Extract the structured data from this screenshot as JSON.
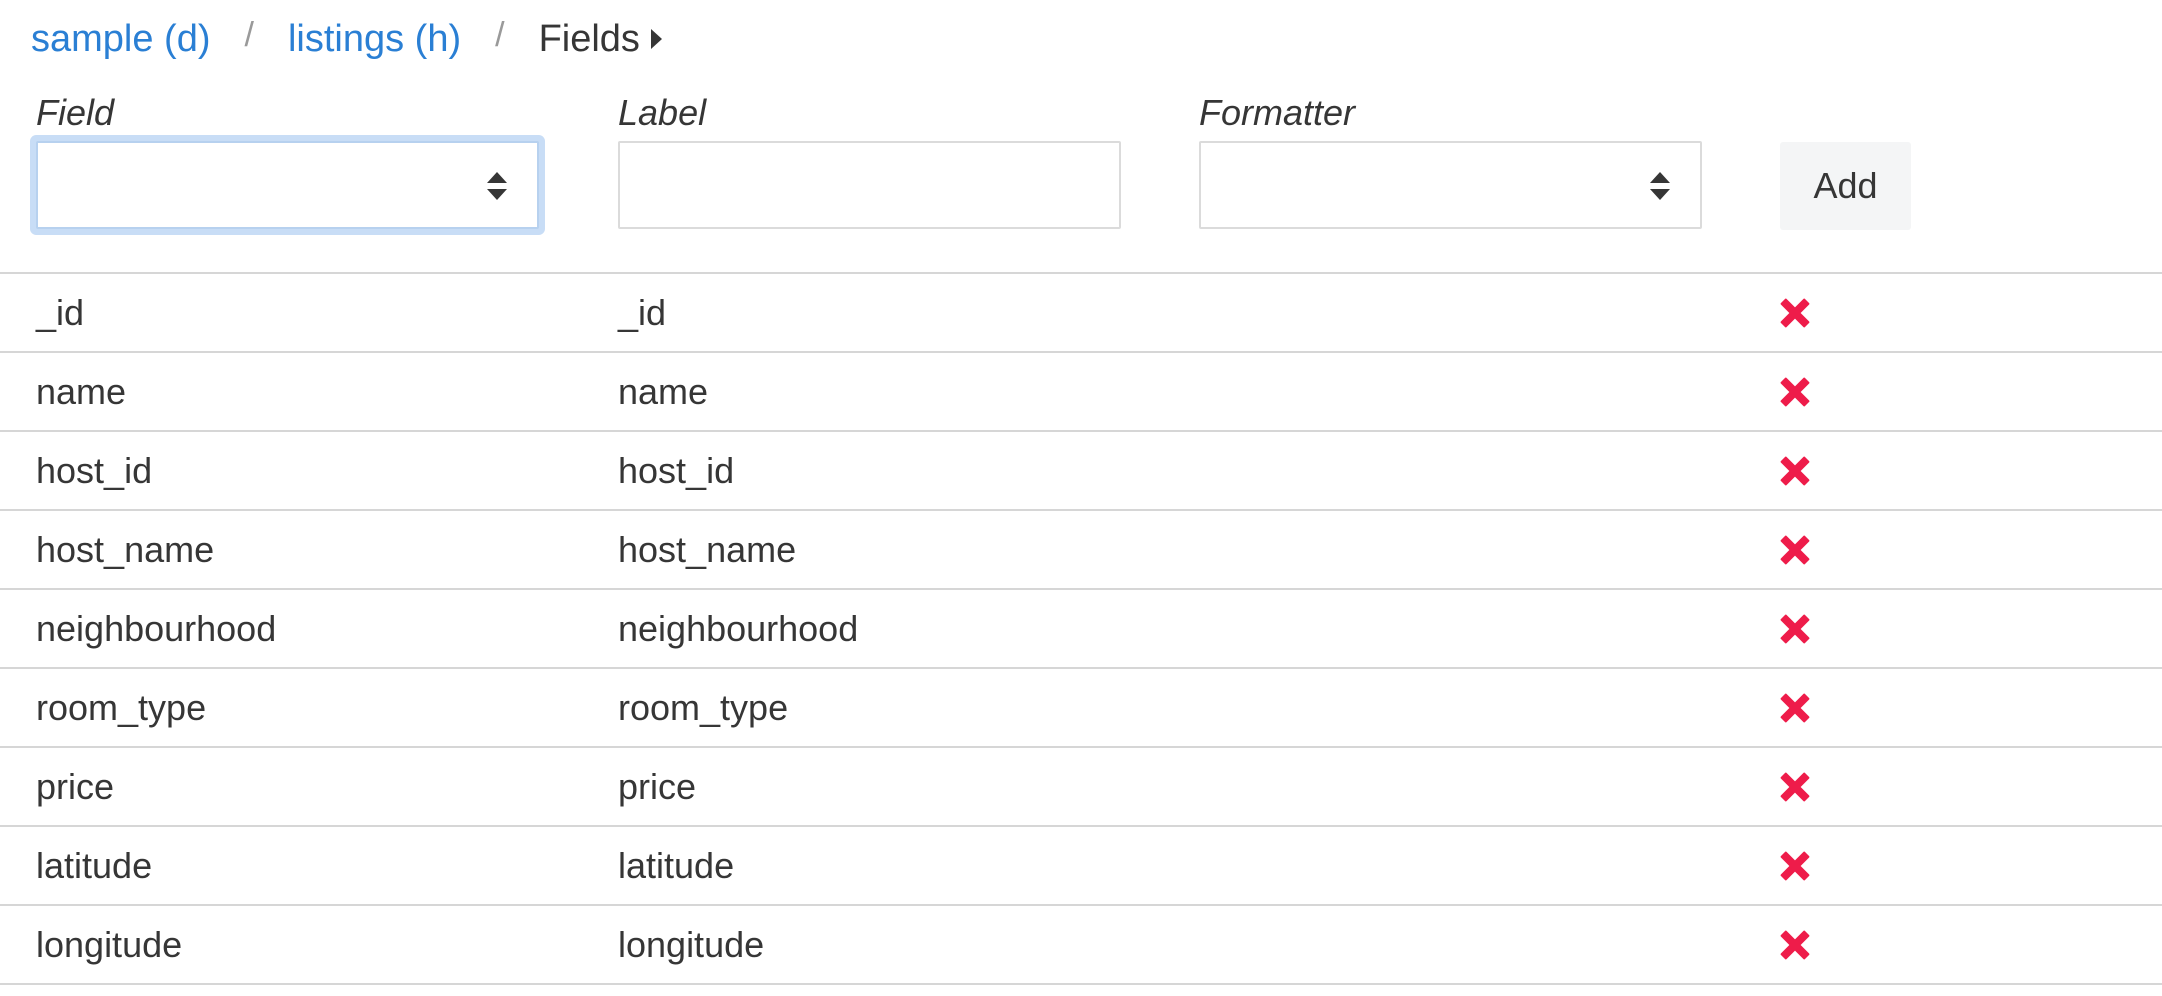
{
  "breadcrumb": {
    "items": [
      {
        "label": "sample (d)"
      },
      {
        "label": "listings (h)"
      }
    ],
    "separator": "/",
    "current": "Fields"
  },
  "form": {
    "field": {
      "label": "Field",
      "value": ""
    },
    "label": {
      "label": "Label",
      "value": ""
    },
    "formatter": {
      "label": "Formatter",
      "value": ""
    },
    "add_label": "Add"
  },
  "rows": [
    {
      "field": "_id",
      "label": "_id"
    },
    {
      "field": "name",
      "label": "name"
    },
    {
      "field": "host_id",
      "label": "host_id"
    },
    {
      "field": "host_name",
      "label": "host_name"
    },
    {
      "field": "neighbourhood",
      "label": "neighbourhood"
    },
    {
      "field": "room_type",
      "label": "room_type"
    },
    {
      "field": "price",
      "label": "price"
    },
    {
      "field": "latitude",
      "label": "latitude"
    },
    {
      "field": "longitude",
      "label": "longitude"
    }
  ],
  "colors": {
    "link": "#2a7fd4",
    "delete": "#ee1c4a",
    "focus": "#c8ddf6"
  },
  "icons": {
    "breadcrumb_caret": "caret-right-icon",
    "select_arrows": "sort-arrows-icon",
    "delete": "close-icon"
  }
}
